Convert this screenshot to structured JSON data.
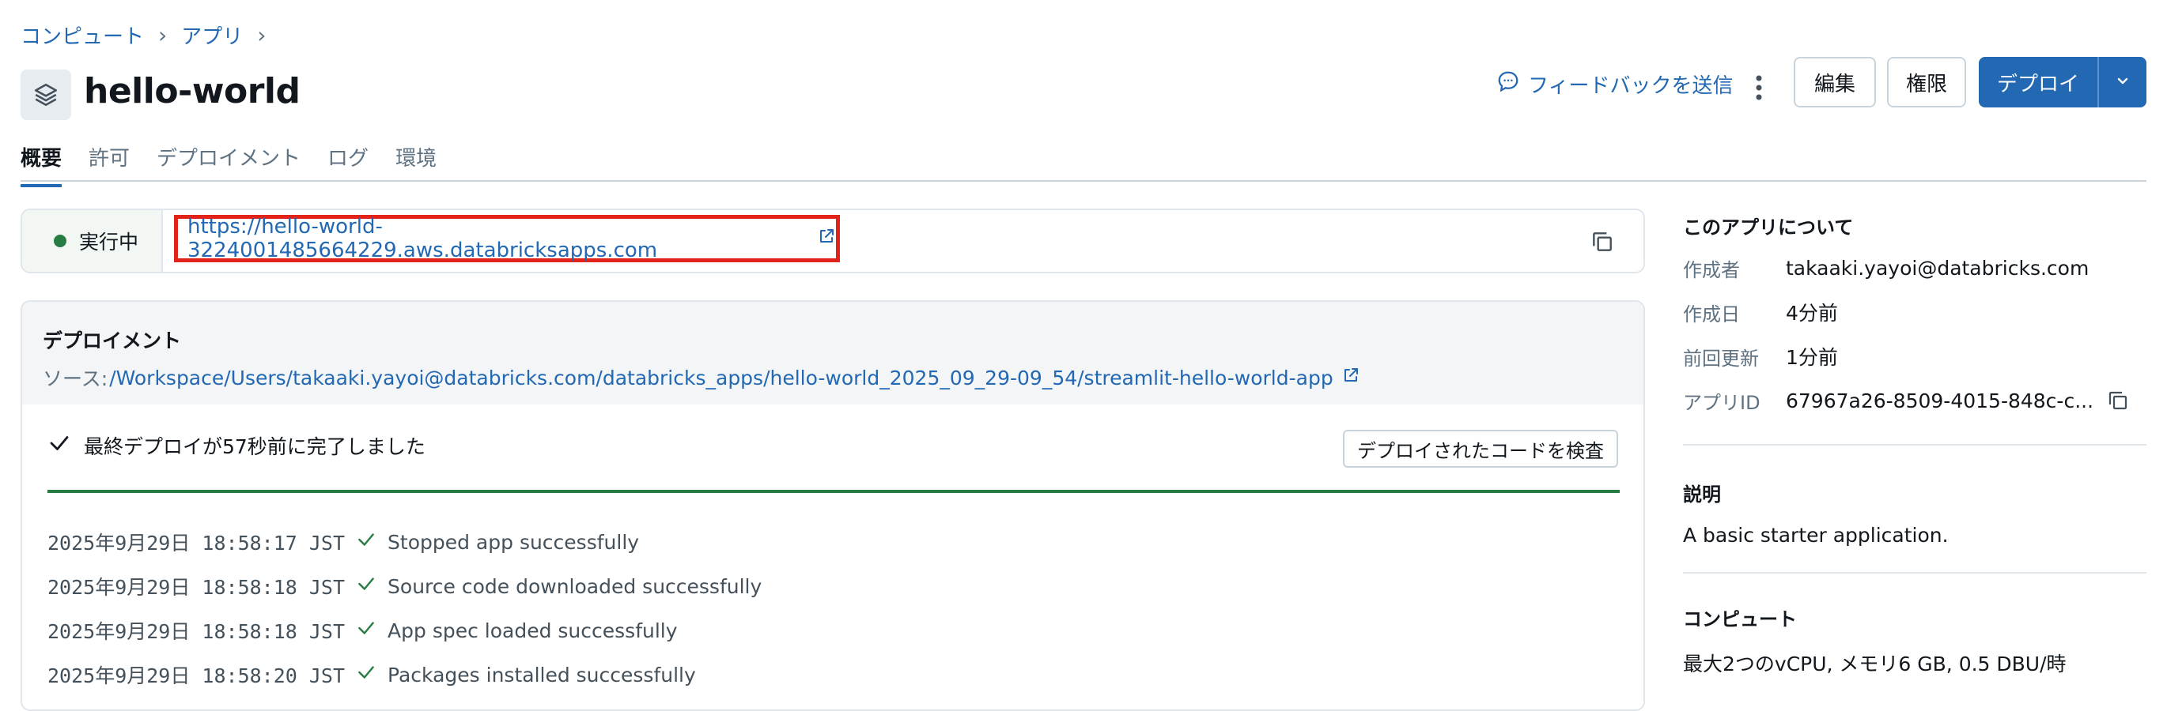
{
  "breadcrumb": {
    "compute": "コンピュート",
    "apps": "アプリ",
    "sep": "›"
  },
  "title": "hello-world",
  "header": {
    "feedback": "フィードバックを送信",
    "edit": "編集",
    "permissions": "権限",
    "deploy": "デプロイ"
  },
  "tabs": [
    "概要",
    "許可",
    "デプロイメント",
    "ログ",
    "環境"
  ],
  "status": {
    "label": "実行中",
    "color": "#277c43"
  },
  "app_url": "https://hello-world-3224001485664229.aws.databricksapps.com",
  "deployment": {
    "title": "デプロイメント",
    "source_prefix": "ソース: ",
    "source_path": "/Workspace/Users/takaaki.yayoi@databricks.com/databricks_apps/hello-world_2025_09_29-09_54/streamlit-hello-world-app",
    "status_text": "最終デプロイが57秒前に完了しました",
    "inspect_button": "デプロイされたコードを検査",
    "progress": 1.0,
    "logs": [
      {
        "ts": "2025年9月29日 18:58:17 JST",
        "msg": "Stopped app successfully"
      },
      {
        "ts": "2025年9月29日 18:58:18 JST",
        "msg": "Source code downloaded successfully"
      },
      {
        "ts": "2025年9月29日 18:58:18 JST",
        "msg": "App spec loaded successfully"
      },
      {
        "ts": "2025年9月29日 18:58:20 JST",
        "msg": "Packages installed successfully"
      }
    ]
  },
  "about": {
    "heading": "このアプリについて",
    "rows": [
      {
        "label": "作成者",
        "value": "takaaki.yayoi@databricks.com"
      },
      {
        "label": "作成日",
        "value": "4分前"
      },
      {
        "label": "前回更新",
        "value": "1分前"
      },
      {
        "label": "アプリID",
        "value": "67967a26-8509-4015-848c-c..."
      }
    ]
  },
  "description": {
    "heading": "説明",
    "text": "A basic starter application."
  },
  "compute": {
    "heading": "コンピュート",
    "text": "最大2つのvCPU, メモリ6 GB, 0.5 DBU/時"
  },
  "colors": {
    "accent": "#2268b2",
    "success": "#277c43",
    "highlight": "#e2231a"
  }
}
